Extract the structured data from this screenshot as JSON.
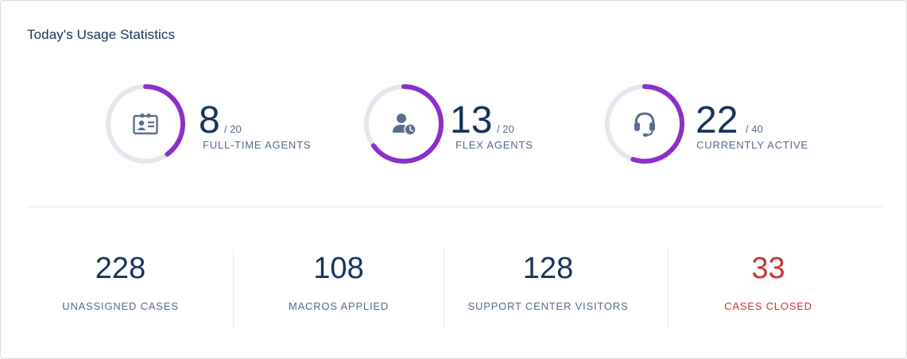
{
  "card": {
    "title": "Today's Usage Statistics"
  },
  "colors": {
    "accent": "#8b2fc9",
    "track": "#e4e7ee",
    "primary_text": "#16325c",
    "muted_text": "#54698d",
    "alert": "#c23934"
  },
  "gauges": [
    {
      "id": "full-time",
      "value": "8",
      "total": "/ 20",
      "label": "FULL-TIME AGENTS",
      "fraction": 0.4,
      "icon": "contact-card-icon"
    },
    {
      "id": "flex",
      "value": "13",
      "total": "/ 20",
      "label": "FLEX AGENTS",
      "fraction": 0.65,
      "icon": "user-clock-icon"
    },
    {
      "id": "active",
      "value": "22",
      "total": "/ 40",
      "label": "CURRENTLY ACTIVE",
      "fraction": 0.55,
      "icon": "headset-icon"
    }
  ],
  "stats": [
    {
      "value": "228",
      "label": "UNASSIGNED CASES"
    },
    {
      "value": "108",
      "label": "MACROS APPLIED"
    },
    {
      "value": "128",
      "label": "SUPPORT CENTER VISITORS"
    },
    {
      "value": "33",
      "label": "CASES CLOSED",
      "alert": true
    }
  ]
}
